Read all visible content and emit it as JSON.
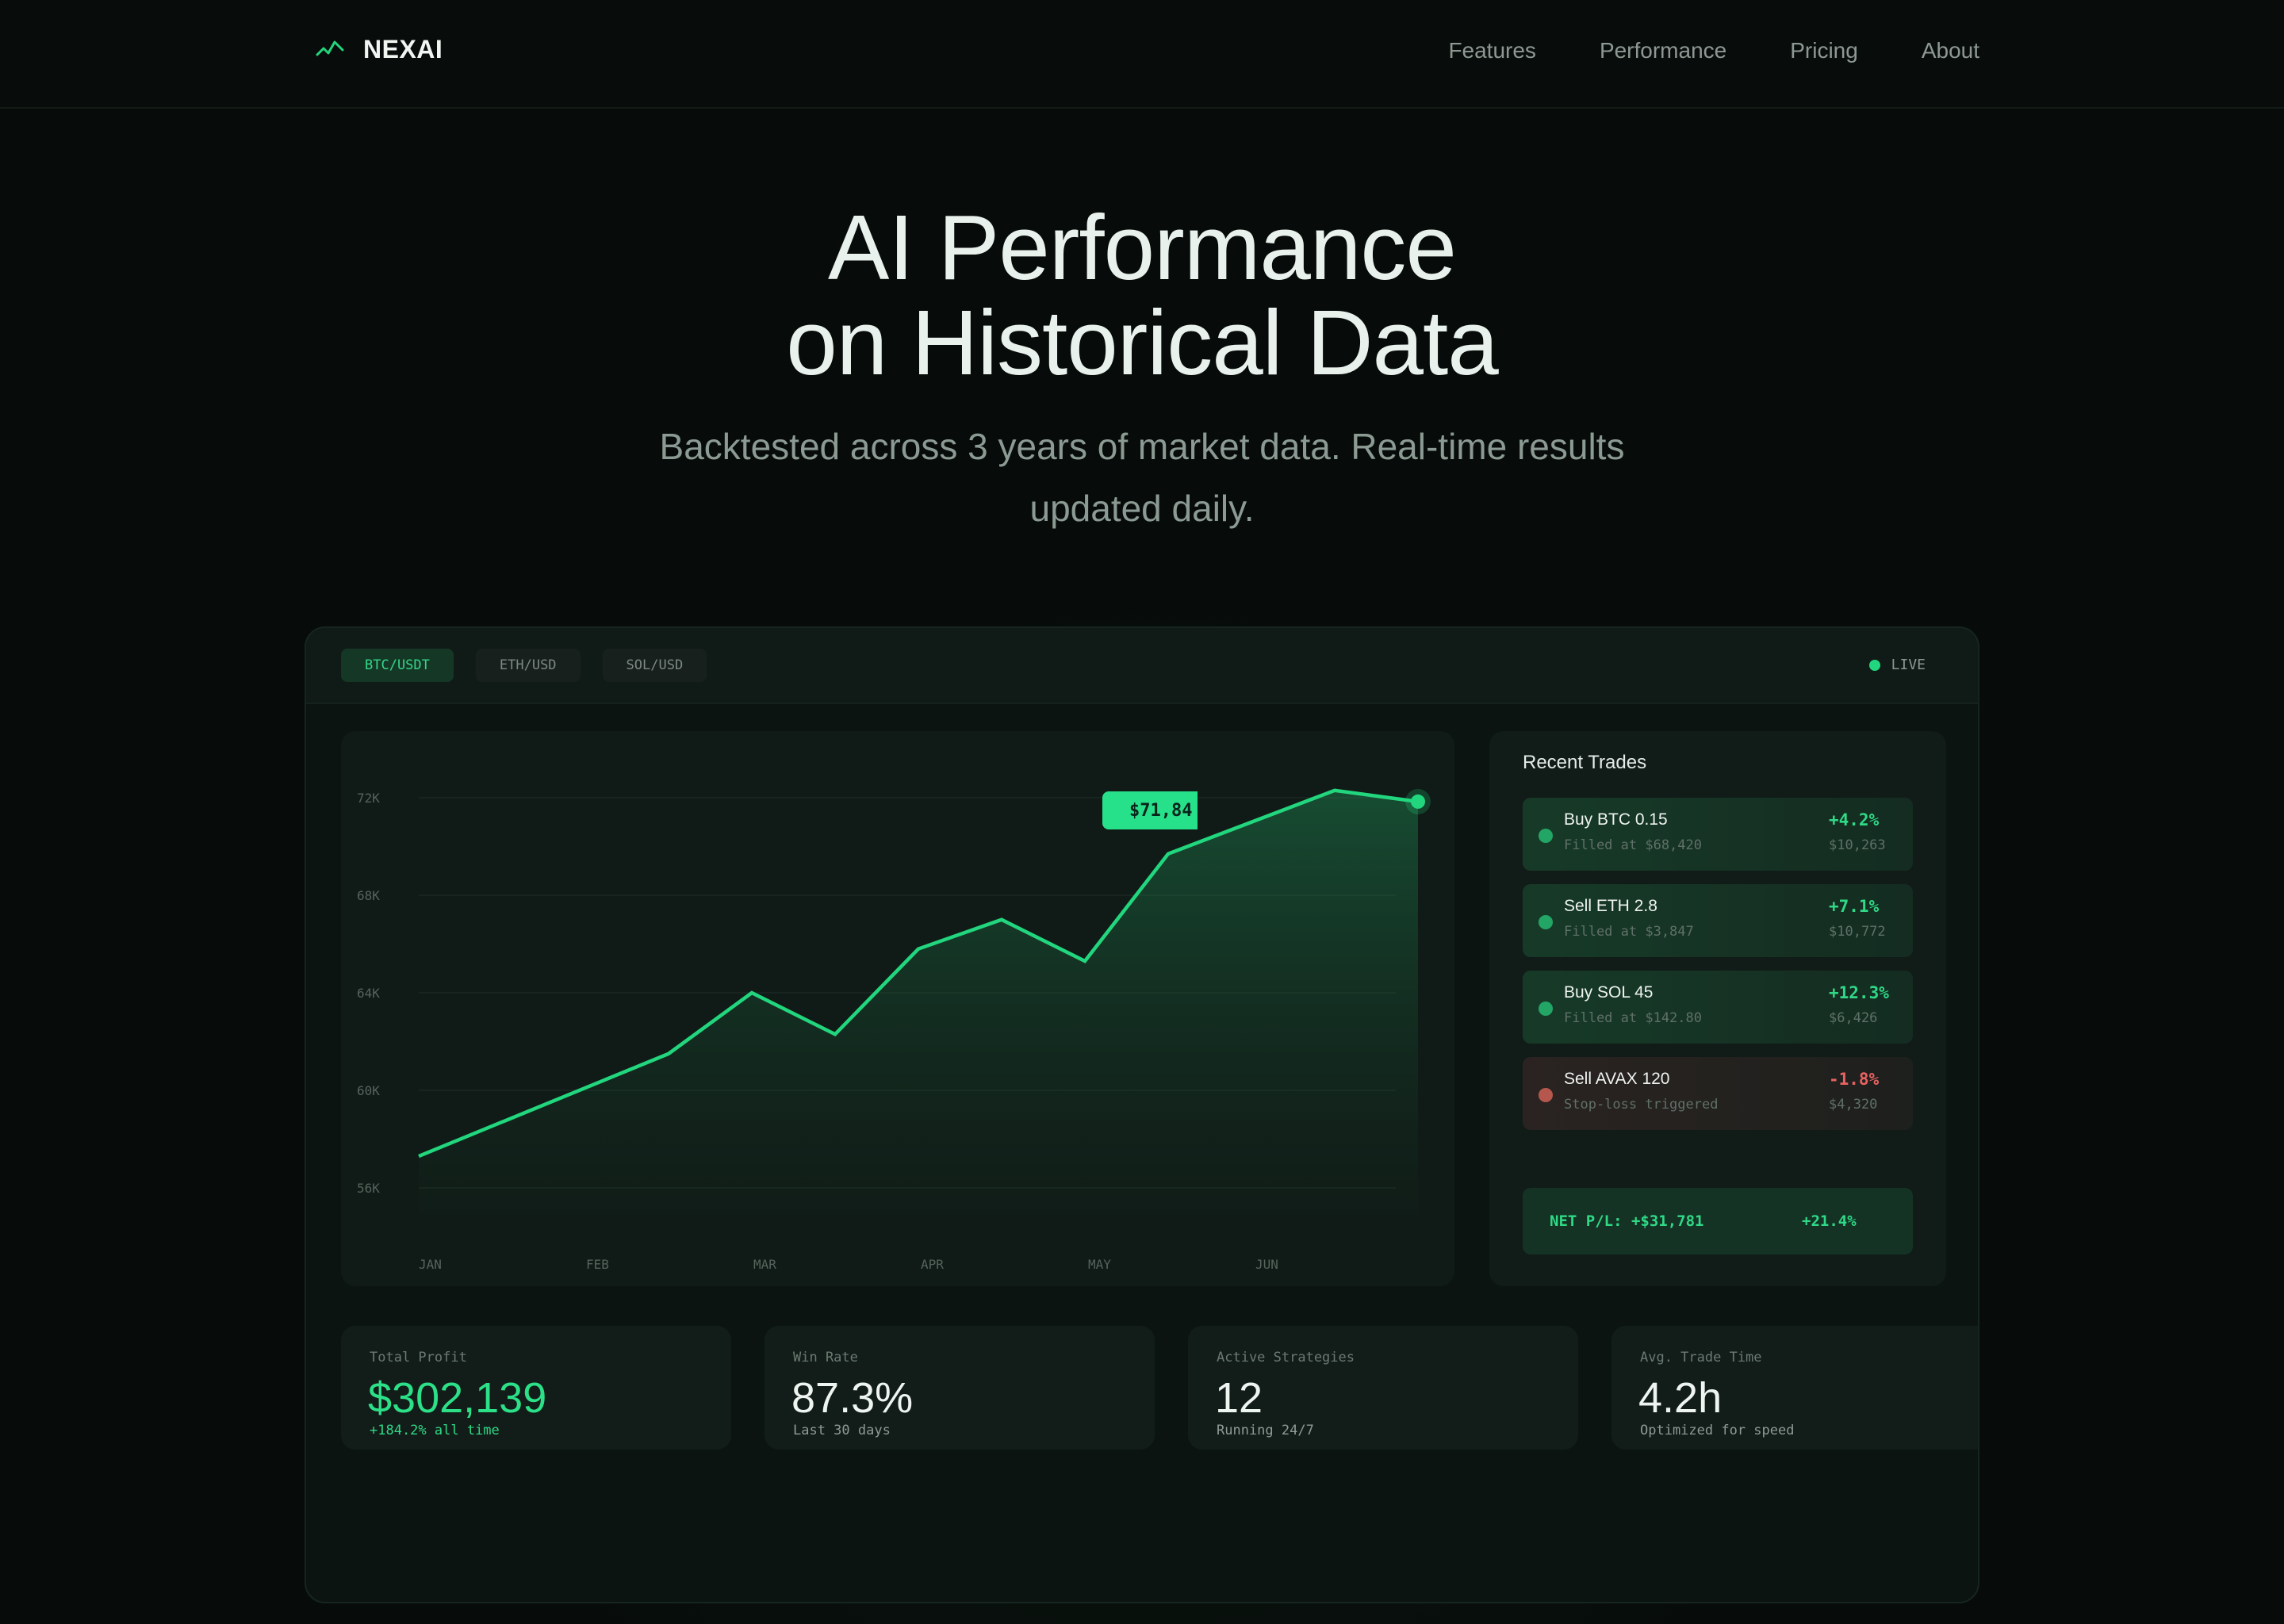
{
  "brand": {
    "name": "NEXAI",
    "logo_icon": "pulse-icon",
    "accent": "#22d67e"
  },
  "nav": {
    "links": [
      "Features",
      "Performance",
      "Pricing",
      "About"
    ]
  },
  "hero": {
    "title_line1": "AI Performance",
    "title_line2": "on Historical Data",
    "subtitle_line1": "Backtested across 3 years of market data. Real-time results",
    "subtitle_line2": "updated daily."
  },
  "dashboard": {
    "tabs": [
      {
        "label": "BTC/USDT",
        "active": true
      },
      {
        "label": "ETH/USD",
        "active": false
      },
      {
        "label": "SOL/USD",
        "active": false
      }
    ],
    "live_label": "LIVE",
    "price_tag": "$71,84",
    "trades_title": "Recent Trades",
    "trades": [
      {
        "name": "Buy BTC 0.15",
        "detail": "Filled at $68,420",
        "pct": "+4.2%",
        "amount": "$10,263",
        "positive": true
      },
      {
        "name": "Sell ETH 2.8",
        "detail": "Filled at $3,847",
        "pct": "+7.1%",
        "amount": "$10,772",
        "positive": true
      },
      {
        "name": "Buy SOL 45",
        "detail": "Filled at $142.80",
        "pct": "+12.3%",
        "amount": "$6,426",
        "positive": true
      },
      {
        "name": "Sell AVAX 120",
        "detail": "Stop-loss triggered",
        "pct": "-1.8%",
        "amount": "$4,320",
        "positive": false
      }
    ],
    "net_label": "NET P/L: +$31,781",
    "net_pct": "+21.4%",
    "stats": [
      {
        "label": "Total Profit",
        "value": "$302,139",
        "sub": "+184.2% all time",
        "highlight": true
      },
      {
        "label": "Win Rate",
        "value": "87.3%",
        "sub": "Last 30 days",
        "highlight": false
      },
      {
        "label": "Active Strategies",
        "value": "12",
        "sub": "Running 24/7",
        "highlight": false
      },
      {
        "label": "Avg. Trade Time",
        "value": "4.2h",
        "sub": "Optimized for speed",
        "highlight": false
      }
    ]
  },
  "chart_data": {
    "type": "area",
    "x": [
      "JAN",
      "",
      "FEB",
      "",
      "MAR",
      "",
      "APR",
      "",
      "MAY",
      "",
      "JUN",
      "",
      ""
    ],
    "x_tick_labels": [
      "JAN",
      "FEB",
      "MAR",
      "APR",
      "MAY",
      "JUN"
    ],
    "y_tick_labels": [
      "72K",
      "68K",
      "64K",
      "60K",
      "56K"
    ],
    "y_ticks": [
      72000,
      68000,
      64000,
      60000,
      56000
    ],
    "values": [
      57300,
      58700,
      60100,
      61500,
      64000,
      62300,
      65800,
      67000,
      65300,
      69700,
      71000,
      72300,
      71840
    ],
    "ylim": [
      54000,
      74000
    ],
    "grid": true,
    "line_color": "#22d67e"
  }
}
